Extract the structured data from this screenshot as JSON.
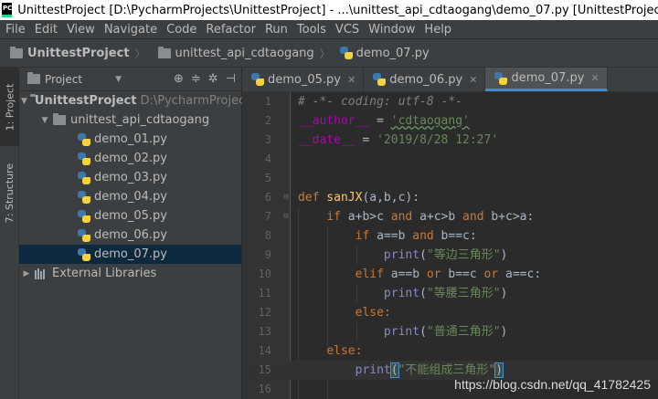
{
  "window": {
    "title": "UnittestProject [D:\\PycharmProjects\\UnittestProject] - ...\\unittest_api_cdtaogang\\demo_07.py [UnittestProject] - PyCharm",
    "logo_text_top": "PC",
    "logo_text_bottom": ""
  },
  "menu": [
    "File",
    "Edit",
    "View",
    "Navigate",
    "Code",
    "Refactor",
    "Run",
    "Tools",
    "VCS",
    "Window",
    "Help"
  ],
  "breadcrumb": [
    "UnittestProject",
    "unittest_api_cdtaogang",
    "demo_07.py"
  ],
  "toolstrip": {
    "project": "1: Project",
    "structure": "7: Structure"
  },
  "panel": {
    "title": "Project"
  },
  "tree": {
    "root": "UnittestProject",
    "root_path": "D:\\PycharmProjec",
    "package": "unittest_api_cdtaogang",
    "files": [
      "demo_01.py",
      "demo_02.py",
      "demo_03.py",
      "demo_04.py",
      "demo_05.py",
      "demo_06.py",
      "demo_07.py"
    ],
    "libraries": "External Libraries"
  },
  "tabs": [
    "demo_05.py",
    "demo_06.py",
    "demo_07.py"
  ],
  "line_numbers": [
    "1",
    "2",
    "3",
    "4",
    "5",
    "6",
    "7",
    "8",
    "9",
    "10",
    "11",
    "12",
    "13",
    "14",
    "15",
    "16"
  ],
  "code": {
    "l1": "# -*- coding: utf-8 -*-",
    "l2_name": "__author__",
    "l2_eq": " = ",
    "l2_val": "'cdtaogang'",
    "l3_name": "__date__",
    "l3_eq": " = ",
    "l3_val": "'2019/8/28 12:27'",
    "l6_kw": "def",
    "l6_fn": " sanJX",
    "l6_rest": "(a,b,c):",
    "l7_kw": "if",
    "l7_a": " a+b>c ",
    "l7_and1": "and",
    "l7_b": " a+c>b ",
    "l7_and2": "and",
    "l7_c": " b+c>a:",
    "l8_kw": "if",
    "l8_a": " a==b ",
    "l8_and": "and",
    "l8_b": " b==c:",
    "l9_fn": "print",
    "l9_open": "(",
    "l9_str": "\"等边三角形\"",
    "l9_close": ")",
    "l10_kw": "elif",
    "l10_a": " a==b ",
    "l10_or1": "or",
    "l10_b": " b==c ",
    "l10_or2": "or",
    "l10_c": " a==c:",
    "l11_fn": "print",
    "l11_open": "(",
    "l11_str": "\"等腰三角形\"",
    "l11_close": ")",
    "l12_kw": "else:",
    "l13_fn": "print",
    "l13_open": "(",
    "l13_str": "\"普通三角形\"",
    "l13_close": ")",
    "l14_kw": "else:",
    "l15_fn": "print",
    "l15_open": "(",
    "l15_str": "\"不能组成三角形\"",
    "l15_close": ")"
  },
  "watermark": "https://blog.csdn.net/qq_41782425",
  "colors": {
    "keyword": "#cc7832",
    "string": "#6a8759",
    "comment": "#808080",
    "accent": "#4a88c7"
  }
}
